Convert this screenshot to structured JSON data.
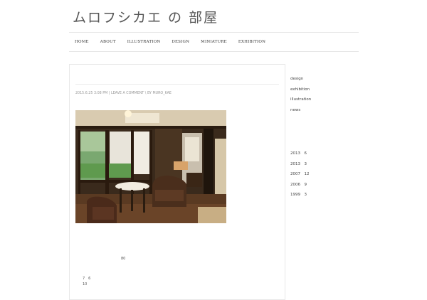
{
  "site": {
    "title": "ムロフシカエ の 部屋"
  },
  "nav": {
    "items": [
      {
        "label": "HOME"
      },
      {
        "label": "ABOUT"
      },
      {
        "label": "ILLUSTRATION"
      },
      {
        "label": "DESIGN"
      },
      {
        "label": "MINIATURE"
      },
      {
        "label": "EXHIBITION"
      }
    ]
  },
  "post": {
    "date": "2015.6.25 3:08 PM",
    "comment_link": "LEAVE A COMMENT",
    "by": "BY",
    "author": "MURO_KAE",
    "text_line1": "80",
    "text_line2": "7　6",
    "text_line3": "10"
  },
  "sidebar": {
    "categories": [
      {
        "label": "design"
      },
      {
        "label": "exhibition"
      },
      {
        "label": "illustration"
      },
      {
        "label": "news"
      }
    ],
    "archives": [
      {
        "label": "2013　6"
      },
      {
        "label": "2013　3"
      },
      {
        "label": "2007　12"
      },
      {
        "label": "2006　9"
      },
      {
        "label": "1999　3"
      }
    ]
  }
}
